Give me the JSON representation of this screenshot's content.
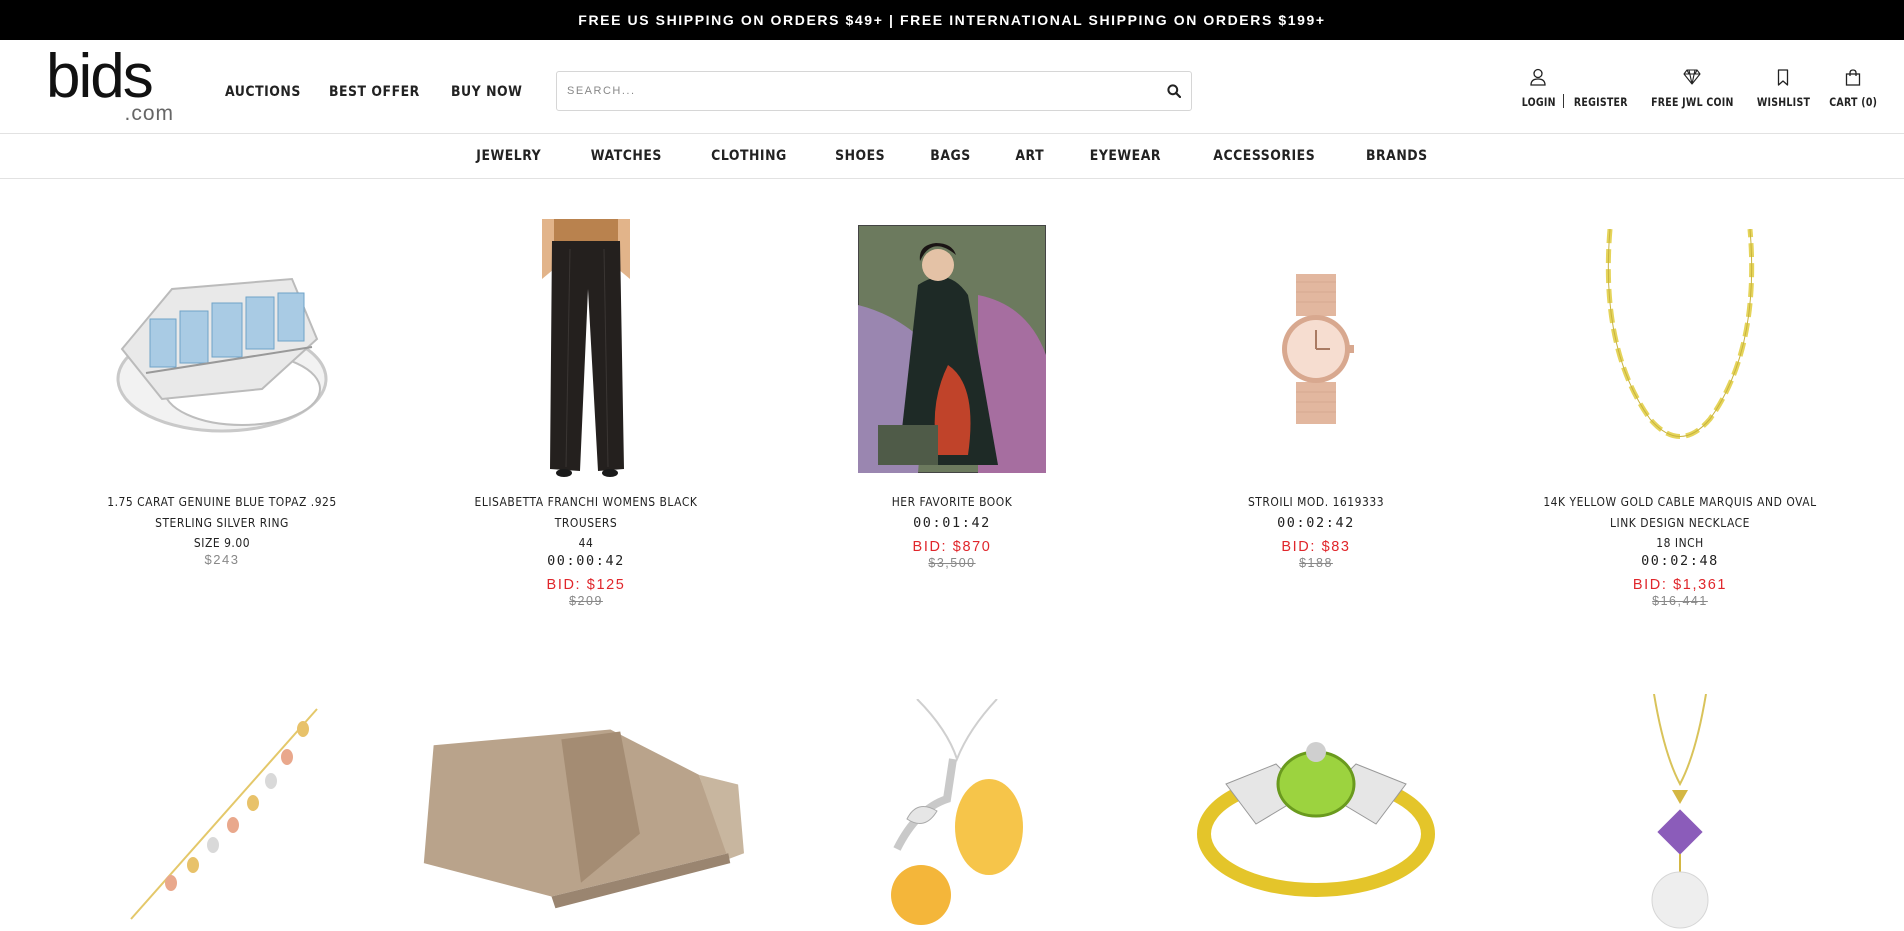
{
  "banner": {
    "text": "FREE US SHIPPING ON ORDERS $49+ | FREE INTERNATIONAL SHIPPING ON ORDERS $199+"
  },
  "logo": {
    "main": "bids",
    "sub": ".com"
  },
  "main_nav": [
    "AUCTIONS",
    "BEST OFFER",
    "BUY NOW"
  ],
  "search": {
    "placeholder": "SEARCH..."
  },
  "user_nav": {
    "login": "LOGIN",
    "register": "REGISTER",
    "free_jwl_coin": "FREE JWL COIN",
    "wishlist": "WISHLIST",
    "cart": "CART (0)"
  },
  "categories": [
    "JEWELRY",
    "WATCHES",
    "CLOTHING",
    "SHOES",
    "BAGS",
    "ART",
    "EYEWEAR",
    "ACCESSORIES",
    "BRANDS"
  ],
  "products": [
    {
      "title": "1.75 CARAT GENUINE BLUE TOPAZ .925 STERLING SILVER RING",
      "sub": "SIZE 9.00",
      "price": "$243"
    },
    {
      "title": "ELISABETTA FRANCHI WOMENS BLACK TROUSERS",
      "sub": "44",
      "timer": "00:00:42",
      "bid": "BID: $125",
      "retail": "$209"
    },
    {
      "title": "HER FAVORITE BOOK",
      "timer": "00:01:42",
      "bid": "BID: $870",
      "retail": "$3,500"
    },
    {
      "title": "STROILI MOD. 1619333",
      "timer": "00:02:42",
      "bid": "BID: $83",
      "retail": "$188"
    },
    {
      "title": "14K YELLOW GOLD CABLE MARQUIS AND OVAL LINK DESIGN NECKLACE",
      "sub": "18 INCH",
      "timer": "00:02:48",
      "bid": "BID: $1,361",
      "retail": "$16,441"
    }
  ],
  "colors": {
    "bid_red": "#e0262b",
    "banner_bg": "#000000"
  }
}
